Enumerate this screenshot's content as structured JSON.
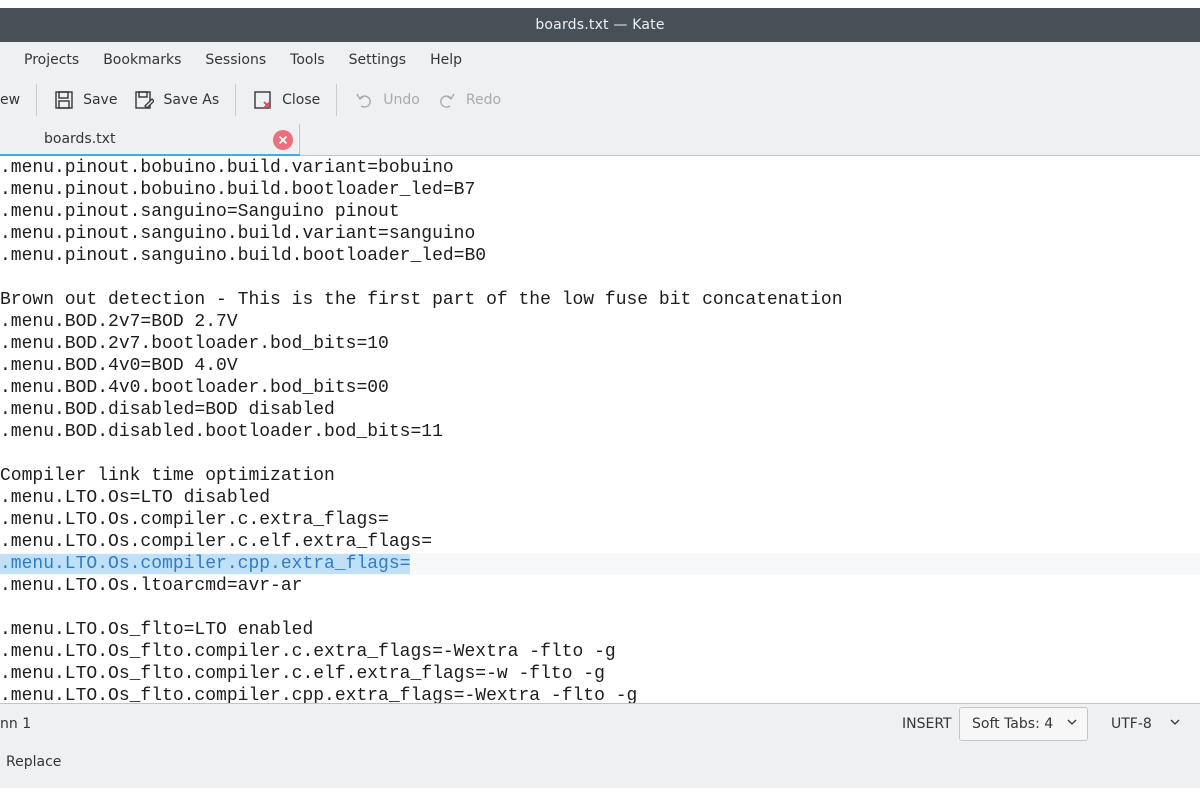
{
  "window": {
    "title": "boards.txt — Kate"
  },
  "menubar": {
    "items": [
      "Projects",
      "Bookmarks",
      "Sessions",
      "Tools",
      "Settings",
      "Help"
    ]
  },
  "toolbar": {
    "new_label": "ew",
    "save_label": "Save",
    "save_as_label": "Save As",
    "close_label": "Close",
    "undo_label": "Undo",
    "redo_label": "Redo"
  },
  "tab": {
    "label": "boards.txt"
  },
  "editor": {
    "lines": [
      ".menu.pinout.bobuino.build.variant=bobuino",
      ".menu.pinout.bobuino.build.bootloader_led=B7",
      ".menu.pinout.sanguino=Sanguino pinout",
      ".menu.pinout.sanguino.build.variant=sanguino",
      ".menu.pinout.sanguino.build.bootloader_led=B0",
      "",
      "Brown out detection - This is the first part of the low fuse bit concatenation",
      ".menu.BOD.2v7=BOD 2.7V",
      ".menu.BOD.2v7.bootloader.bod_bits=10",
      ".menu.BOD.4v0=BOD 4.0V",
      ".menu.BOD.4v0.bootloader.bod_bits=00",
      ".menu.BOD.disabled=BOD disabled",
      ".menu.BOD.disabled.bootloader.bod_bits=11",
      "",
      "Compiler link time optimization",
      ".menu.LTO.Os=LTO disabled",
      ".menu.LTO.Os.compiler.c.extra_flags=",
      ".menu.LTO.Os.compiler.c.elf.extra_flags=",
      ".menu.LTO.Os.compiler.cpp.extra_flags=",
      ".menu.LTO.Os.ltoarcmd=avr-ar",
      "",
      ".menu.LTO.Os_flto=LTO enabled",
      ".menu.LTO.Os_flto.compiler.c.extra_flags=-Wextra -flto -g",
      ".menu.LTO.Os_flto.compiler.c.elf.extra_flags=-w -flto -g",
      ".menu.LTO.Os_flto.compiler.cpp.extra_flags=-Wextra -flto -g"
    ],
    "selected_line_index": 18
  },
  "statusbar": {
    "position": "nn 1",
    "mode": "INSERT",
    "indent": "Soft Tabs: 4",
    "encoding": "UTF-8"
  },
  "bottombar": {
    "replace_label": "Replace"
  }
}
